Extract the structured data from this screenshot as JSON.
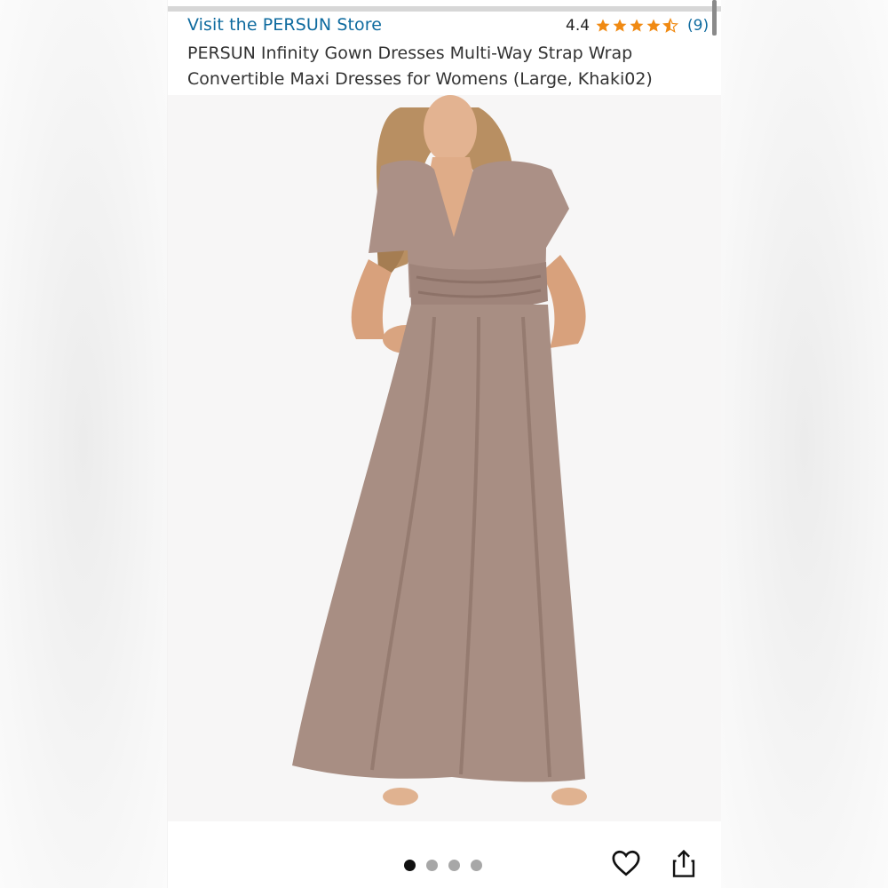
{
  "header": {
    "store_link": "Visit the PERSUN Store",
    "rating_value": "4.4",
    "rating_stars": 4.4,
    "rating_count": "(9)",
    "star_color": "#f08a13",
    "product_title": "PERSUN Infinity Gown Dresses Multi-Way Strap Wrap Convertible Maxi Dresses for Womens (Large, Khaki02)"
  },
  "gallery": {
    "image_description_icon": "product-photo",
    "page_count": 4,
    "active_page": 1,
    "dress_color": "#a98f83"
  },
  "actions": {
    "wishlist_icon": "heart-icon",
    "share_icon": "share-icon"
  }
}
